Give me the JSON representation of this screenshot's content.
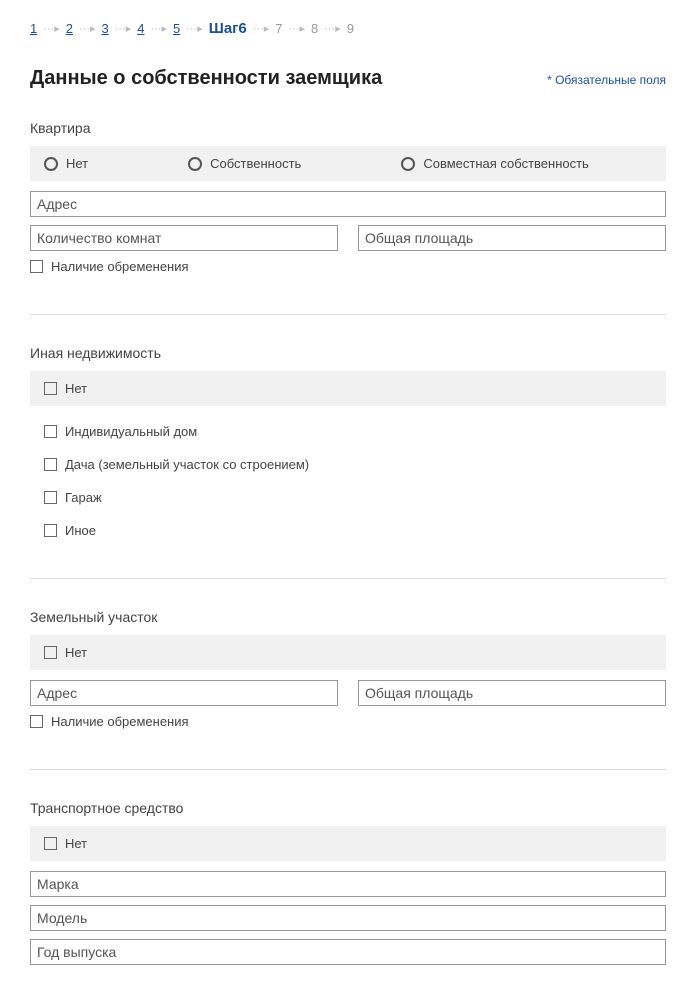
{
  "stepper": {
    "steps": [
      "1",
      "2",
      "3",
      "4",
      "5"
    ],
    "current": "Шаг6",
    "future": [
      "7",
      "8",
      "9"
    ]
  },
  "header": {
    "title": "Данные о собственности заемщика",
    "required_note": "*  Обязательные поля"
  },
  "apartment": {
    "title": "Квартира",
    "opt_none": "Нет",
    "opt_own": "Собственность",
    "opt_joint": "Совместная собственность",
    "address_ph": "Адрес",
    "rooms_ph": "Количество комнат",
    "area_ph": "Общая площадь",
    "encumbrance": "Наличие обременения"
  },
  "other_realty": {
    "title": "Иная недвижимость",
    "opt_none": "Нет",
    "house": "Индивидуальный дом",
    "dacha": "Дача (земельный участок со строением)",
    "garage": "Гараж",
    "other": "Иное"
  },
  "land": {
    "title": "Земельный участок",
    "opt_none": "Нет",
    "address_ph": "Адрес",
    "area_ph": "Общая площадь",
    "encumbrance": "Наличие обременения"
  },
  "vehicle": {
    "title": "Транспортное средство",
    "opt_none": "Нет",
    "brand_ph": "Марка",
    "model_ph": "Модель",
    "year_ph": "Год выпуска"
  }
}
